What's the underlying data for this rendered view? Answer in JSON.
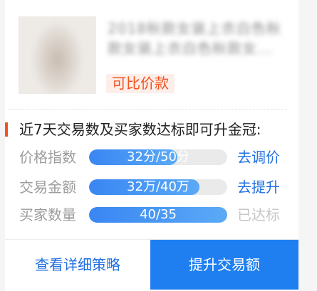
{
  "product": {
    "title": "2018秋款女装上衣白色秋款女装上衣白色秋款女...",
    "tag": "可比价款"
  },
  "upgrade": {
    "heading": "近7天交易数及买家数达标即可升金冠:",
    "rows": [
      {
        "label": "价格指数",
        "progress_text": "32分/50分",
        "progress": 0.64,
        "action": "去调价",
        "status": "action"
      },
      {
        "label": "交易金额",
        "progress_text": "32万/40万",
        "progress": 0.8,
        "action": "去提升",
        "status": "action"
      },
      {
        "label": "买家数量",
        "progress_text": "40/35",
        "progress": 1.0,
        "action": "已达标",
        "status": "done"
      }
    ]
  },
  "footer": {
    "secondary_label": "查看详细策略",
    "primary_label": "提升交易额"
  },
  "colors": {
    "accent": "#f4521e",
    "link": "#1f6fe0",
    "primary_button": "#1f7ff0",
    "bar_fill_start": "#3a86f3",
    "bar_fill_end": "#5aaaf6"
  }
}
